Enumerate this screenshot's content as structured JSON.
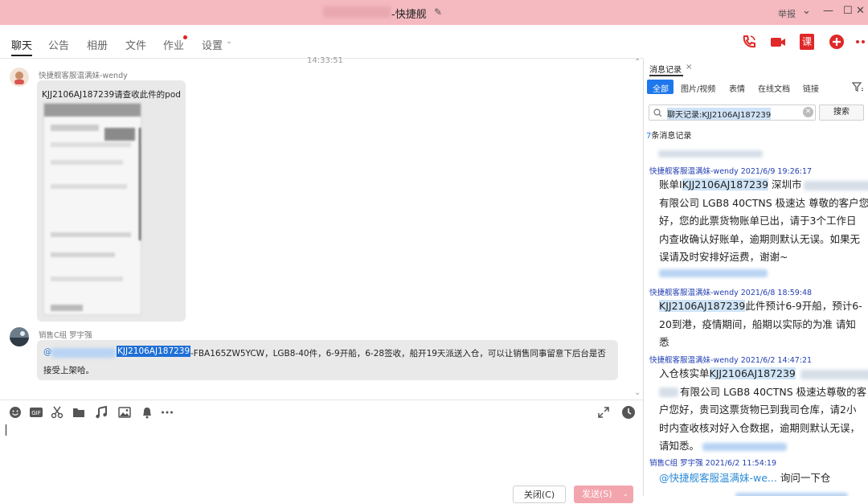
{
  "window": {
    "title": "-快捷舰",
    "report": "举报"
  },
  "tabs": [
    {
      "label": "聊天"
    },
    {
      "label": "公告"
    },
    {
      "label": "相册"
    },
    {
      "label": "文件"
    },
    {
      "label": "作业"
    },
    {
      "label": "设置"
    }
  ],
  "header_icons": {
    "class_label": "课"
  },
  "chat": {
    "time": "14:33:51",
    "messages": [
      {
        "sender": "快捷舰客服温满妹-wendy",
        "text": "KJJ2106AJ187239请查收此件的pod"
      },
      {
        "sender": "销售C组 罗宇强",
        "mention": "@",
        "highlight": "KJJ2106AJ187239",
        "text_line1": "-FBA165ZW5YCW，LGB8-40件，6-9开船，6-28签收，船开19天派送入仓，可以让销售同事留意下后台是否",
        "text_line2": "接受上架哈。"
      }
    ]
  },
  "composer": {
    "close_label": "关闭(C)",
    "send_label": "发送(S)"
  },
  "panel": {
    "title": "消息记录",
    "filters": [
      {
        "label": "全部"
      },
      {
        "label": "图片/视频"
      },
      {
        "label": "表情"
      },
      {
        "label": "在线文档"
      },
      {
        "label": "链接"
      }
    ],
    "search_value": "聊天记录:KJJ2106AJ187239",
    "search_button": "搜索",
    "count_num": "7",
    "count_text": "条消息记录",
    "results": [
      {
        "header": "快捷舰客服温满妹-wendy 2021/6/9 19:26:17",
        "l1a": "账单I",
        "l1hl": "KJJ2106AJ187239",
        "l1b": " 深圳市",
        "l2": "有限公司 LGB8 40CTNS 极速达 尊敬的客户您",
        "l3": "好，您的此票货物账单已出，请于3个工作日",
        "l4": "内查收确认好账单，逾期则默认无误。如果无",
        "l5": "误请及时安排好运费，谢谢~"
      },
      {
        "header": "快捷舰客服温满妹-wendy 2021/6/8 18:59:48",
        "l1hl": "KJJ2106AJ187239",
        "l1b": "此件预计6-9开船，预计6-",
        "l2": "20到港，疫情期间，船期以实际的为准  请知",
        "l3": "悉"
      },
      {
        "header": "快捷舰客服温满妹-wendy 2021/6/2 14:47:21",
        "l1a": "入仓核实单",
        "l1hl": "KJJ2106AJ187239",
        "l2": "有限公司 LGB8 40CTNS 极速达尊敬的客",
        "l3": "户您好，贵司这票货物已到我司仓库，请2小",
        "l4": "时内查收核对好入仓数据，逾期则默认无误，",
        "l5": "请知悉。"
      },
      {
        "header": "销售C组 罗宇强 2021/6/2 11:54:19",
        "mention": "@快捷舰客服温满妹-we...",
        "l1b": " 询问一下仓"
      }
    ]
  }
}
